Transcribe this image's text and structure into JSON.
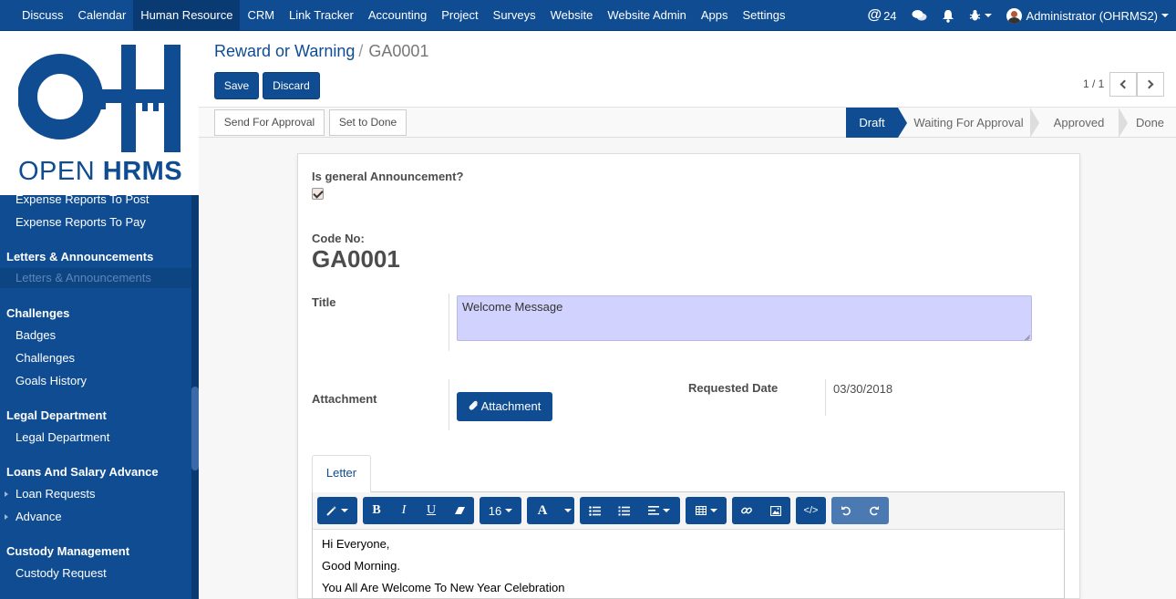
{
  "topnav": {
    "menu": [
      "Discuss",
      "Calendar",
      "Human Resource",
      "CRM",
      "Link Tracker",
      "Accounting",
      "Project",
      "Surveys",
      "Website",
      "Website Admin",
      "Apps",
      "Settings"
    ],
    "active_menu": "Human Resource",
    "mention_count": "24",
    "user_label": "Administrator (OHRMS2)"
  },
  "logo": {
    "text_light": "OPEN ",
    "text_bold": "HRMS"
  },
  "sidebar": {
    "items_top": [
      "Expense Reports To Post",
      "Expense Reports To Pay"
    ],
    "sections": [
      {
        "title": "Letters & Announcements",
        "items": [
          "Letters & Announcements"
        ]
      },
      {
        "title": "Challenges",
        "items": [
          "Badges",
          "Challenges",
          "Goals History"
        ]
      },
      {
        "title": "Legal Department",
        "items": [
          "Legal Department"
        ]
      },
      {
        "title": "Loans And Salary Advance",
        "items": [
          "Loan Requests",
          "Advance"
        ]
      },
      {
        "title": "Custody Management",
        "items": [
          "Custody Request"
        ]
      }
    ]
  },
  "breadcrumb": {
    "parent": "Reward or Warning",
    "separator": "/",
    "current": "GA0001"
  },
  "buttons": {
    "save": "Save",
    "discard": "Discard",
    "send_for_approval": "Send For Approval",
    "set_to_done": "Set to Done",
    "attachment": "Attachment"
  },
  "pager": {
    "value": "1 / 1"
  },
  "stages": [
    "Draft",
    "Waiting For Approval",
    "Approved",
    "Done"
  ],
  "active_stage": "Draft",
  "form": {
    "general_label": "Is general Announcement?",
    "general_checked": true,
    "code_label": "Code No:",
    "code_value": "GA0001",
    "title_label": "Title",
    "title_value": "Welcome Message",
    "attachment_label": "Attachment",
    "requested_date_label": "Requested Date",
    "requested_date_value": "03/30/2018"
  },
  "tabs": [
    "Letter"
  ],
  "editor": {
    "font_size": "16",
    "font_color_label": "A",
    "content": [
      "Hi Everyone,",
      "Good Morning.",
      "You All Are Welcome To New Year Celebration"
    ]
  },
  "colors": {
    "brand": "#0f4c92",
    "title_bg": "#d2d2ff"
  }
}
